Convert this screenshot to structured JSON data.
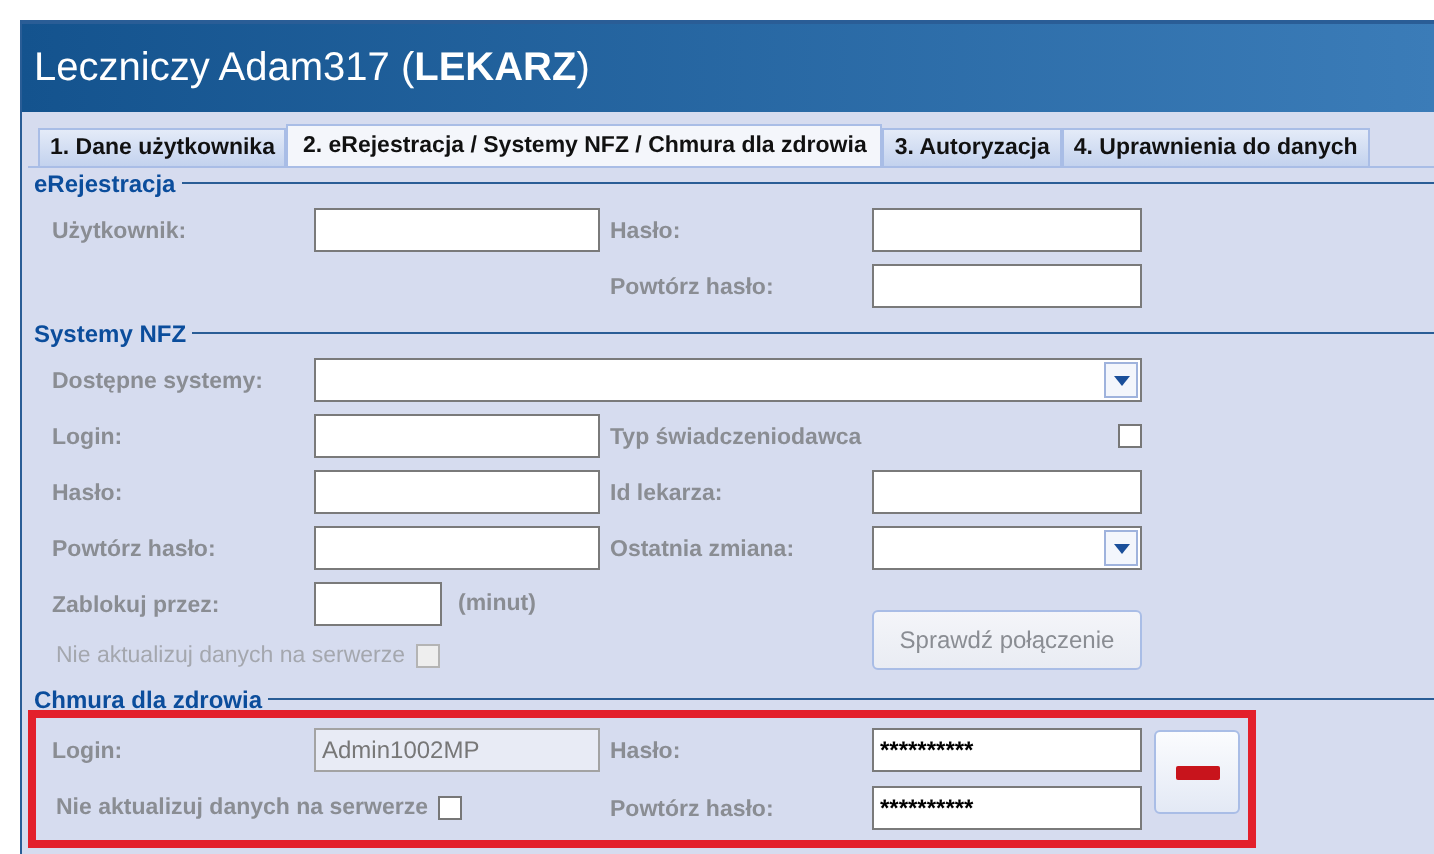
{
  "window": {
    "title": "Leczniczy Adam317 (**LEKARZ**)"
  },
  "tabs": [
    {
      "label": "1. Dane użytkownika",
      "selected": false
    },
    {
      "label": "2. eRejestracja / Systemy NFZ / Chmura dla zdrowia",
      "selected": true
    },
    {
      "label": "3. Autoryzacja",
      "selected": false
    },
    {
      "label": "4. Uprawnienia do danych",
      "selected": false
    }
  ],
  "erejestracja": {
    "title": "eRejestracja",
    "user_label": "Użytkownik:",
    "password_label": "Hasło:",
    "repeat_label": "Powtórz hasło:"
  },
  "systemy_nfz": {
    "title": "Systemy NFZ",
    "systems_label": "Dostępne systemy:",
    "login_label": "Login:",
    "provider_type": {
      "label": "Typ świadczeniodawca",
      "checked": false
    },
    "password_label": "Hasło:",
    "doctor_id_label": "Id lekarza:",
    "repeat_label": "Powtórz hasło:",
    "last_change_label": "Ostatnia zmiana:",
    "lock_label": "Zablokuj przez:",
    "lock_unit": "(minut)",
    "no_update": {
      "label": "Nie aktualizuj danych na serwerze",
      "checked": false,
      "disabled": true
    },
    "test_button": {
      "label": "Sprawdź połączenie",
      "disabled": true
    }
  },
  "chmura": {
    "title": "Chmura dla zdrowia",
    "highlighted": true,
    "login": {
      "label": "Login:",
      "value": "Admin1002MP",
      "readonly": true
    },
    "password": {
      "label": "Hasło:",
      "value": "**********"
    },
    "no_update": {
      "label": "Nie aktualizuj danych na serwerze",
      "checked": false,
      "disabled": false
    },
    "repeat": {
      "label": "Powtórz hasło:",
      "value": "**********"
    }
  }
}
